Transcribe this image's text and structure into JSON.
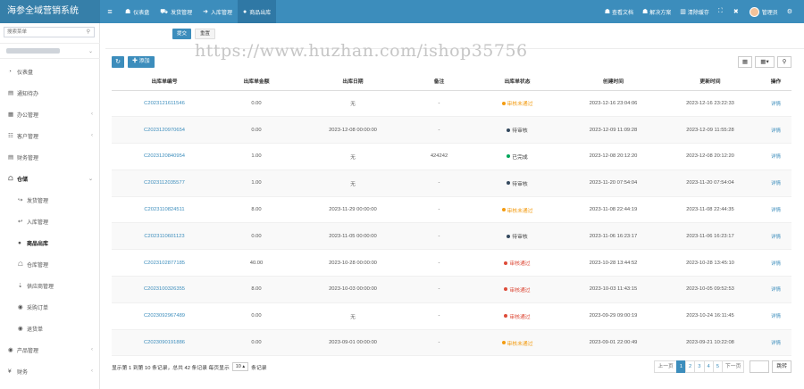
{
  "app": {
    "title": "海参全域营销系统"
  },
  "colors": {
    "primary": "#3c8dbc",
    "danger": "#dd4b39",
    "warning": "#f39c12",
    "success": "#00a65a"
  },
  "topnav": [
    {
      "icon": "dashboard-icon",
      "glyph": "☗",
      "label": "仪表盘",
      "active": false
    },
    {
      "icon": "truck-icon",
      "glyph": "⛟",
      "label": "发货管理",
      "active": false
    },
    {
      "icon": "sign-in-icon",
      "glyph": "➜",
      "label": "入库管理",
      "active": false
    },
    {
      "icon": "circle-icon",
      "glyph": "●",
      "label": "商品出库",
      "active": true
    }
  ],
  "topright": {
    "docs": "查看文档",
    "solutions": "解决方案",
    "clear_cache": "清除缓存",
    "user": "管理员"
  },
  "sidebar": {
    "search_placeholder": "搜索菜单",
    "items": [
      {
        "icon": "dashboard-icon",
        "glyph": "◔",
        "label": "仪表盘",
        "sub": false,
        "arrow": ""
      },
      {
        "icon": "notice-icon",
        "glyph": "▤",
        "label": "通知待办",
        "sub": false,
        "arrow": ""
      },
      {
        "icon": "office-icon",
        "glyph": "▦",
        "label": "办公管理",
        "sub": false,
        "arrow": "‹"
      },
      {
        "icon": "customer-icon",
        "glyph": "☷",
        "label": "客户管理",
        "sub": false,
        "arrow": "‹"
      },
      {
        "icon": "finance-icon",
        "glyph": "▤",
        "label": "财务管理",
        "sub": false,
        "arrow": ""
      },
      {
        "icon": "warehouse-icon",
        "glyph": "☖",
        "label": "仓储",
        "sub": false,
        "arrow": "⌄",
        "open": true
      },
      {
        "icon": "ship-icon",
        "glyph": "↪",
        "label": "发货管理",
        "sub": true,
        "arrow": ""
      },
      {
        "icon": "sign-in-icon",
        "glyph": "↩",
        "label": "入库管理",
        "sub": true,
        "arrow": ""
      },
      {
        "icon": "outbound-icon",
        "glyph": "●",
        "label": "商品出库",
        "sub": true,
        "arrow": "",
        "current": true
      },
      {
        "icon": "inventory-icon",
        "glyph": "☖",
        "label": "仓库管理",
        "sub": true,
        "arrow": ""
      },
      {
        "icon": "supplier-icon",
        "glyph": "⇣",
        "label": "供应商管理",
        "sub": true,
        "arrow": ""
      },
      {
        "icon": "purchase-icon",
        "glyph": "◉",
        "label": "采购订单",
        "sub": true,
        "arrow": ""
      },
      {
        "icon": "return-icon",
        "glyph": "◉",
        "label": "退货单",
        "sub": true,
        "arrow": ""
      },
      {
        "icon": "product-icon",
        "glyph": "◉",
        "label": "产品管理",
        "sub": false,
        "arrow": "‹"
      },
      {
        "icon": "yen-icon",
        "glyph": "¥",
        "label": "财务",
        "sub": false,
        "arrow": "‹"
      }
    ]
  },
  "query": {
    "submit": "提交",
    "reset": "重置"
  },
  "toolbar": {
    "refresh_icon": "↻",
    "add_label": "✚ 添加",
    "columns_icon": "▦",
    "grid_icon": "▦▾",
    "search_icon": "⚲"
  },
  "table": {
    "headers": [
      "出库单编号",
      "出库单金额",
      "出库日期",
      "备注",
      "出库单状态",
      "创建时间",
      "更新时间",
      "操作"
    ],
    "rows": [
      {
        "no": "C2023121611546",
        "amount": "0.00",
        "date": "无",
        "remark": "-",
        "status": "审核未通过",
        "status_type": "orange",
        "created": "2023-12-16 23:04:06",
        "updated": "2023-12-16 23:22:33",
        "action": "详情"
      },
      {
        "no": "C2023120970654",
        "amount": "0.00",
        "date": "2023-12-08 00:00:00",
        "remark": "-",
        "status": "待审核",
        "status_type": "dark",
        "created": "2023-12-09 11:09:28",
        "updated": "2023-12-09 11:55:28",
        "action": "详情"
      },
      {
        "no": "C2023120840954",
        "amount": "1.00",
        "date": "无",
        "remark": "424242",
        "status": "已完成",
        "status_type": "green",
        "created": "2023-12-08 20:12:20",
        "updated": "2023-12-08 20:12:20",
        "action": "详情"
      },
      {
        "no": "C2023112035577",
        "amount": "1.00",
        "date": "无",
        "remark": "-",
        "status": "待审核",
        "status_type": "dark",
        "created": "2023-11-20 07:54:04",
        "updated": "2023-11-20 07:54:04",
        "action": "详情"
      },
      {
        "no": "C2023110824511",
        "amount": "8.00",
        "date": "2023-11-29 00:00:00",
        "remark": "-",
        "status": "审核未通过",
        "status_type": "orange",
        "created": "2023-11-08 22:44:19",
        "updated": "2023-11-08 22:44:35",
        "action": "详情"
      },
      {
        "no": "C2023110601123",
        "amount": "0.00",
        "date": "2023-11-05 00:00:00",
        "remark": "-",
        "status": "待审核",
        "status_type": "dark",
        "created": "2023-11-06 16:23:17",
        "updated": "2023-11-06 16:23:17",
        "action": "详情"
      },
      {
        "no": "C2023102877185",
        "amount": "40.00",
        "date": "2023-10-28 00:00:00",
        "remark": "-",
        "status": "审核通过",
        "status_type": "red",
        "created": "2023-10-28 13:44:52",
        "updated": "2023-10-28 13:45:10",
        "action": "详情"
      },
      {
        "no": "C2023100326355",
        "amount": "8.00",
        "date": "2023-10-03 00:00:00",
        "remark": "-",
        "status": "审核通过",
        "status_type": "red",
        "created": "2023-10-03 11:43:15",
        "updated": "2023-10-05 09:52:53",
        "action": "详情"
      },
      {
        "no": "C2023092967489",
        "amount": "0.00",
        "date": "无",
        "remark": "-",
        "status": "审核通过",
        "status_type": "red",
        "created": "2023-09-29 09:00:19",
        "updated": "2023-10-24 16:11:45",
        "action": "详情"
      },
      {
        "no": "C2023090191886",
        "amount": "0.00",
        "date": "2023-09-01 00:00:00",
        "remark": "-",
        "status": "审核未通过",
        "status_type": "orange",
        "created": "2023-09-01 22:00:49",
        "updated": "2023-09-21 10:22:08",
        "action": "详情"
      }
    ]
  },
  "pagination": {
    "info_prefix": "显示第 1 到第 10 条记录，总共 42 条记录 每页显示",
    "page_size": "10 ▴",
    "info_suffix": "条记录",
    "prev": "上一页",
    "pages": [
      "1",
      "2",
      "3",
      "4",
      "5"
    ],
    "active_page": "1",
    "next": "下一页",
    "go": "跳转"
  },
  "watermark": "https://www.huzhan.com/ishop35756"
}
